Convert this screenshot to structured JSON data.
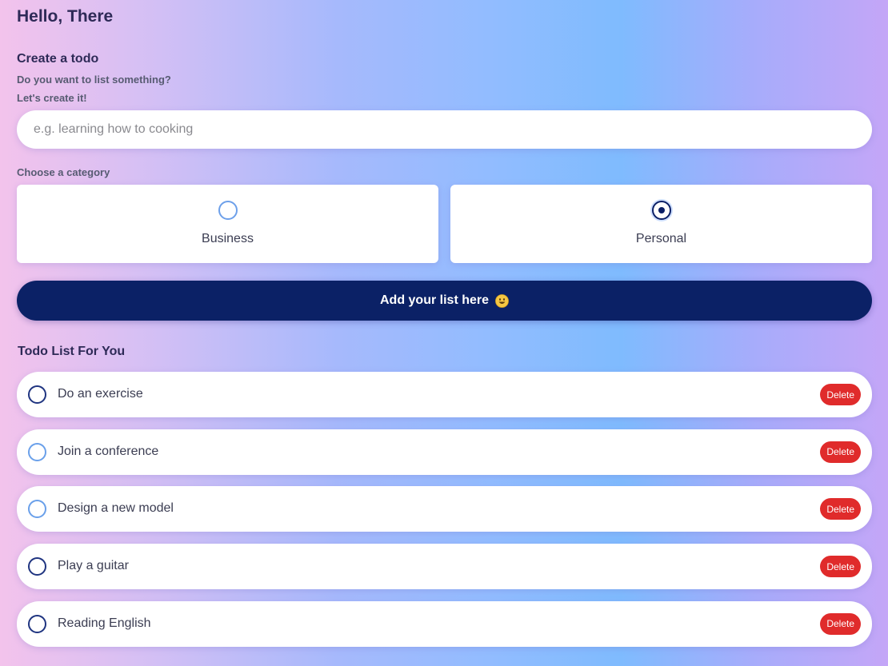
{
  "header": {
    "greeting": "Hello, There"
  },
  "create": {
    "title": "Create a todo",
    "subtitle_1": "Do you want to list something?",
    "subtitle_2": "Let's create it!",
    "input_placeholder": "e.g. learning how to cooking",
    "input_value": ""
  },
  "category": {
    "label": "Choose a category",
    "options": [
      {
        "label": "Business",
        "selected": false
      },
      {
        "label": "Personal",
        "selected": true
      }
    ]
  },
  "add_button": {
    "label": "Add your list here",
    "icon": "smile-emoji-icon"
  },
  "todo_list": {
    "title": "Todo List For You",
    "delete_label": "Delete",
    "items": [
      {
        "text": "Do an exercise",
        "checkbox_style": "dark"
      },
      {
        "text": "Join a conference",
        "checkbox_style": "light"
      },
      {
        "text": "Design a new model",
        "checkbox_style": "light"
      },
      {
        "text": "Play a guitar",
        "checkbox_style": "dark"
      },
      {
        "text": "Reading English",
        "checkbox_style": "dark"
      }
    ]
  },
  "colors": {
    "primary": "#0b2166",
    "delete": "#e02b2b",
    "radio_unselected": "#6da0ea",
    "text_dark": "#2e2a57"
  }
}
